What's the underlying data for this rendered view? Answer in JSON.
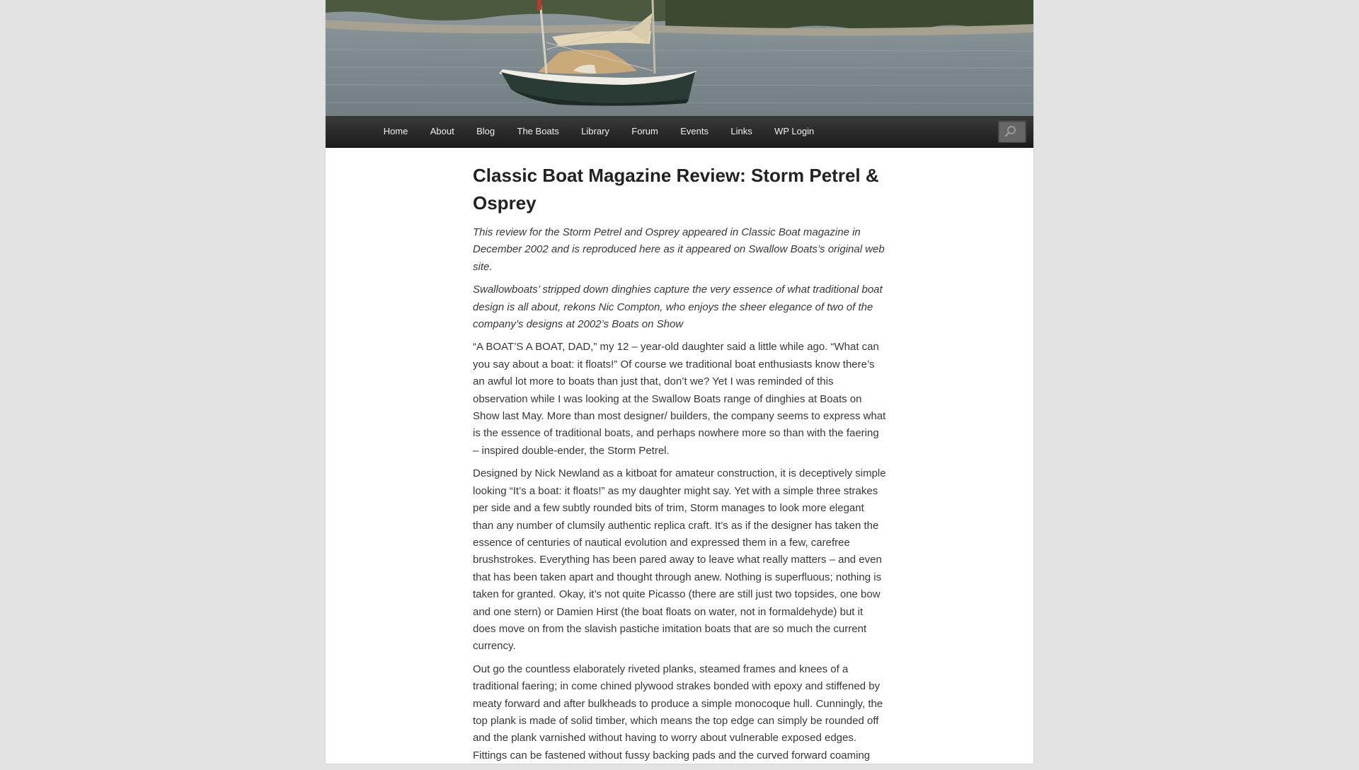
{
  "nav": {
    "items": [
      {
        "label": "Home"
      },
      {
        "label": "About"
      },
      {
        "label": "Blog"
      },
      {
        "label": "The Boats"
      },
      {
        "label": "Library"
      },
      {
        "label": "Forum"
      },
      {
        "label": "Events"
      },
      {
        "label": "Links"
      },
      {
        "label": "WP Login"
      }
    ],
    "search_icon": "search-icon"
  },
  "article": {
    "title": "Classic Boat Magazine Review: Storm Petrel & Osprey",
    "intro_1": "This review for the Storm Petrel and Osprey appeared in Classic Boat magazine in December 2002 and is reproduced here as it appeared on Swallow Boats’s original web site.",
    "intro_2": "Swallowboats’ stripped down dinghies capture the very essence of what traditional boat design is all about, rekons Nic Compton, who enjoys the sheer elegance of two of the company’s designs at 2002’s Boats on Show",
    "body_1": "“A BOAT’S A BOAT, DAD,” my 12 – year-old daughter said a little while ago. “What can you say about a boat: it floats!” Of course we traditional boat enthusiasts know there’s an awful lot more to boats than just that, don’t we? Yet I was reminded of this observation while I was looking at the Swallow Boats range of dinghies at Boats on Show last May. More than most designer/ builders, the company seems to express what is the essence of traditional boats, and perhaps nowhere more so than with the faering – inspired double-ender, the Storm Petrel.",
    "body_2": "Designed by Nick Newland as a kitboat for amateur construction, it is deceptively simple looking “It’s a boat: it floats!” as my daughter might say. Yet with a simple three strakes per side and a few subtly rounded bits of trim, Storm manages to look more elegant than any number of clumsily authentic replica craft. It’s as if the designer has taken the essence of centuries of nautical evolution and expressed them in a few, carefree brushstrokes. Everything has been pared away to leave what really matters – and even that has been taken apart and thought through anew. Nothing is superfluous; nothing is taken for granted. Okay, it’s not quite Picasso (there are still just two topsides, one bow and one stern) or Damien Hirst (the boat floats on water, not in formaldehyde) but it does move on from the slavish pastiche imitation boats that are so much the current currency.",
    "body_3": "Out go the countless elaborately riveted planks, steamed frames and knees of a traditional faering; in come chined plywood strakes bonded with epoxy and stiffened by meaty forward and after bulkheads to produce a simple monocoque hull. Cunningly, the top plank is made of solid timber, which means the top edge can simply be rounded off and the plank varnished without having to worry about vulnerable exposed edges. Fittings can be fastened without fussy backing pads and the curved forward coaming"
  }
}
